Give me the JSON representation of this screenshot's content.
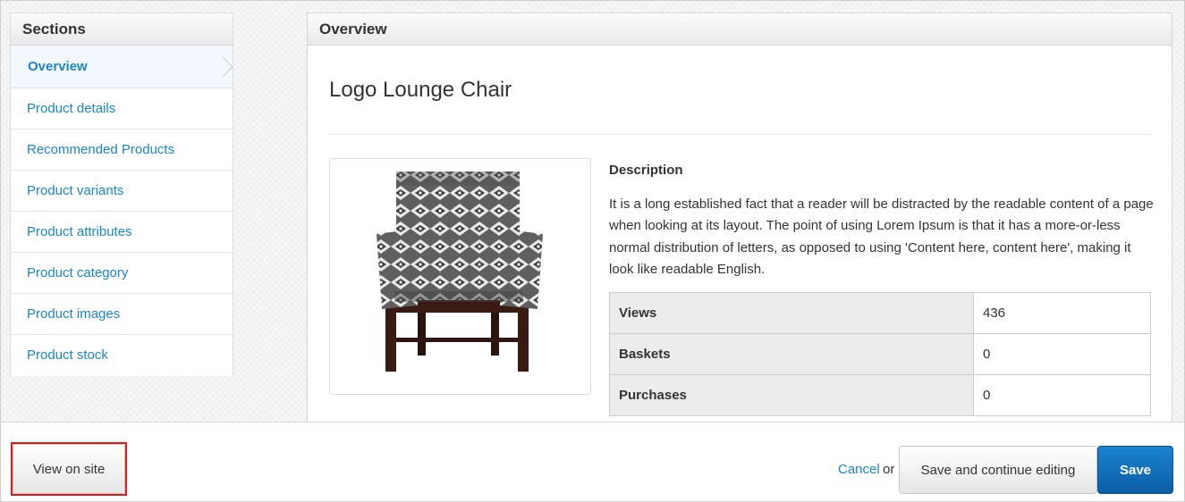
{
  "sidebar": {
    "title": "Sections",
    "items": [
      {
        "label": "Overview"
      },
      {
        "label": "Product details"
      },
      {
        "label": "Recommended Products"
      },
      {
        "label": "Product variants"
      },
      {
        "label": "Product attributes"
      },
      {
        "label": "Product category"
      },
      {
        "label": "Product images"
      },
      {
        "label": "Product stock"
      }
    ]
  },
  "panel": {
    "title": "Overview",
    "product_name": "Logo Lounge Chair",
    "description_heading": "Description",
    "description": "It is a long established fact that a reader will be distracted by the readable content of a page when looking at its layout. The point of using Lorem Ipsum is that it has a more-or-less normal distribution of letters, as opposed to using 'Content here, content here', making it look like readable English.",
    "stats": [
      {
        "label": "Views",
        "value": "436"
      },
      {
        "label": "Baskets",
        "value": "0"
      },
      {
        "label": "Purchases",
        "value": "0"
      }
    ]
  },
  "footer": {
    "view_on_site": "View on site",
    "cancel": "Cancel",
    "or": "or",
    "save_continue": "Save and continue editing",
    "save": "Save"
  },
  "colors": {
    "link": "#1a86c8",
    "primary": "#0b5ea6",
    "highlight": "#e01a1a"
  }
}
